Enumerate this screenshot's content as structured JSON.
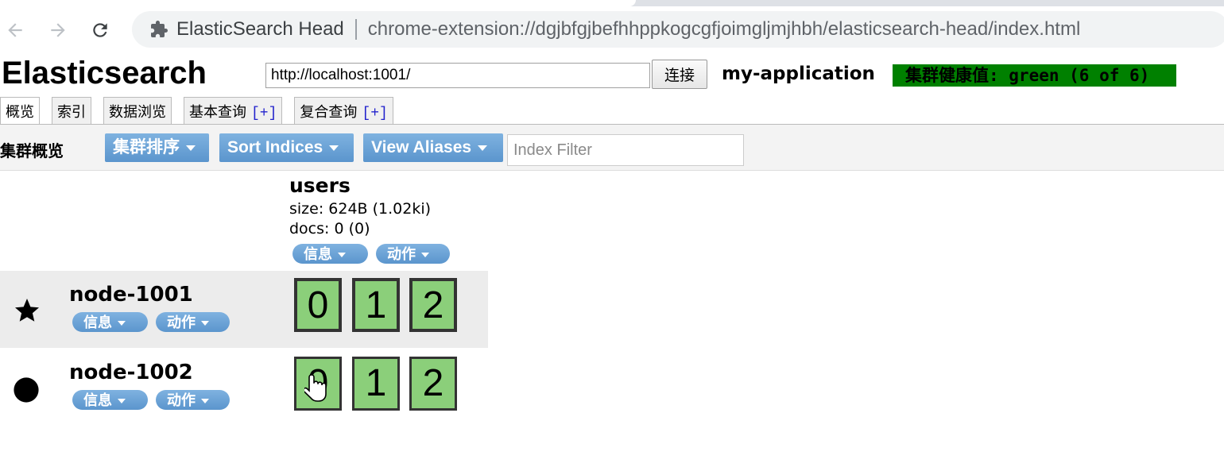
{
  "browser": {
    "page_title": "ElasticSearch Head",
    "url": "chrome-extension://dgjbfgjbefhhppkogcgfjoimgljmjhbh/elasticsearch-head/index.html",
    "icons": {
      "back": "arrow-left-icon",
      "forward": "arrow-right-icon",
      "reload": "reload-icon",
      "extension": "puzzle-icon"
    }
  },
  "header": {
    "brand": "Elasticsearch",
    "connect_url": "http://localhost:1001/",
    "connect_label": "连接",
    "cluster_name": "my-application",
    "health": "集群健康值: green (6 of 6)",
    "health_color": "#008000"
  },
  "tabs": [
    {
      "label": "概览",
      "plus": ""
    },
    {
      "label": "索引",
      "plus": ""
    },
    {
      "label": "数据浏览",
      "plus": ""
    },
    {
      "label": "基本查询",
      "plus": "[+]"
    },
    {
      "label": "复合查询",
      "plus": "[+]"
    }
  ],
  "toolbar": {
    "title": "集群概览",
    "sort_cluster": "集群排序",
    "sort_indices": "Sort Indices",
    "view_aliases": "View Aliases",
    "filter_placeholder": "Index Filter"
  },
  "index": {
    "name": "users",
    "size": "size: 624B (1.02ki)",
    "docs": "docs: 0 (0)",
    "info_label": "信息",
    "action_label": "动作"
  },
  "nodes": [
    {
      "name": "node-1001",
      "icon": "star-icon",
      "info_label": "信息",
      "action_label": "动作",
      "shards": [
        "0",
        "1",
        "2"
      ],
      "role": "master"
    },
    {
      "name": "node-1002",
      "icon": "circle-icon",
      "info_label": "信息",
      "action_label": "动作",
      "shards": [
        "0",
        "1",
        "2"
      ],
      "role": "data"
    }
  ],
  "colors": {
    "button_blue": "#5b95cd",
    "shard_green": "#8bcf7a"
  }
}
